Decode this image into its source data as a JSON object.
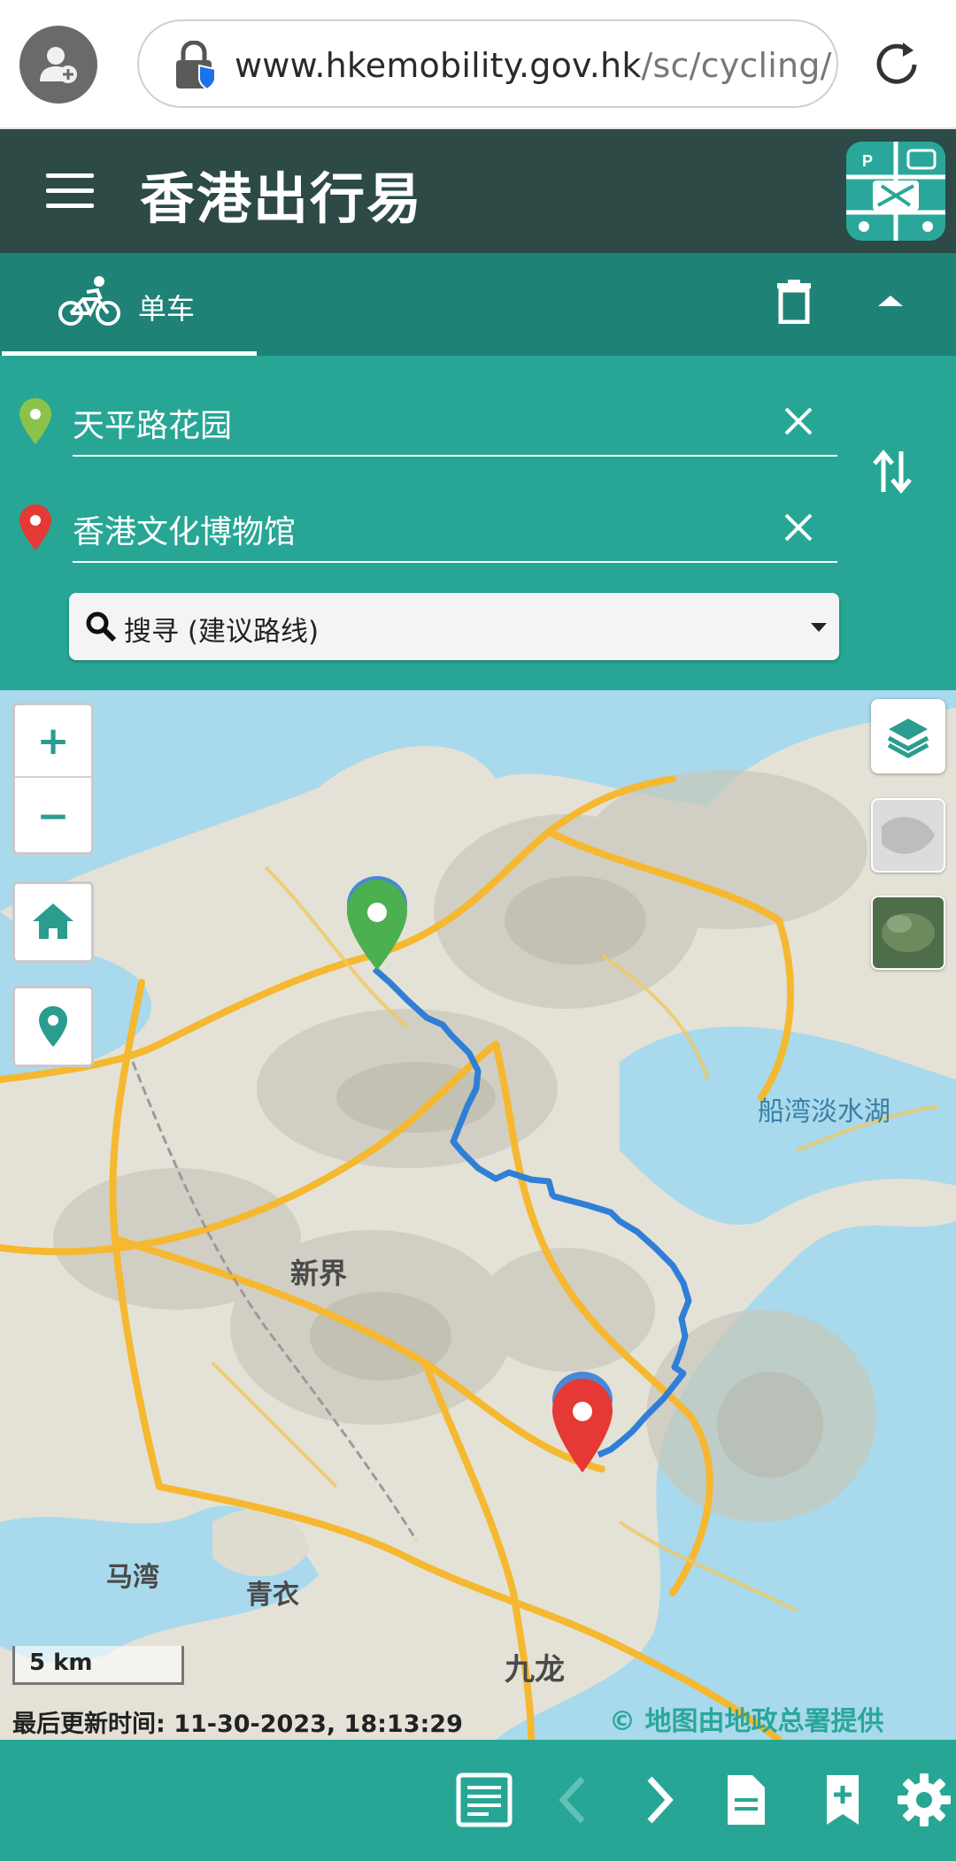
{
  "browser": {
    "url_domain": "www.hkemobility.gov.hk",
    "url_path": "/sc/cycling/"
  },
  "header": {
    "title": "香港出行易"
  },
  "tabs": {
    "active_label": "单车"
  },
  "route": {
    "origin": "天平路花园",
    "destination": "香港文化博物馆",
    "search_option": "搜寻 (建议路线)"
  },
  "map": {
    "labels": {
      "new_territories": "新界",
      "plover_cove": "船湾淡水湖",
      "ma_wan": "马湾",
      "tsing_yi": "青衣",
      "kowloon": "九龙"
    },
    "scale": "5 km",
    "last_updated": "最后更新时间: 11-30-2023, 18:13:29",
    "credit": "© 地图由地政总署提供"
  },
  "colors": {
    "header_bg": "#2d4a47",
    "tab_bg": "#1f8276",
    "panel_bg": "#28a695",
    "route_line": "#2f7fd6",
    "origin_pin": "#4caf50",
    "dest_pin": "#e53935"
  }
}
